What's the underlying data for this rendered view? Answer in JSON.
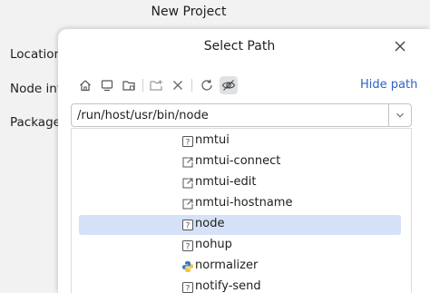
{
  "background": {
    "title": "New Project",
    "location_label": "Location:",
    "node_label": "Node int",
    "package_label": "Package"
  },
  "dialog": {
    "title": "Select Path",
    "hide_path_label": "Hide path",
    "path_value": "/run/host/usr/bin/node"
  },
  "files": [
    {
      "name": "nmtui",
      "icon": "unknown-file-icon",
      "selected": false
    },
    {
      "name": "nmtui-connect",
      "icon": "symlink-icon",
      "selected": false
    },
    {
      "name": "nmtui-edit",
      "icon": "symlink-icon",
      "selected": false
    },
    {
      "name": "nmtui-hostname",
      "icon": "symlink-icon",
      "selected": false
    },
    {
      "name": "node",
      "icon": "unknown-file-icon",
      "selected": true
    },
    {
      "name": "nohup",
      "icon": "unknown-file-icon",
      "selected": false
    },
    {
      "name": "normalizer",
      "icon": "python-file-icon",
      "selected": false
    },
    {
      "name": "notify-send",
      "icon": "unknown-file-icon",
      "selected": false
    }
  ],
  "colors": {
    "accent_link": "#2f62c9",
    "selection": "#d5e1f7"
  }
}
